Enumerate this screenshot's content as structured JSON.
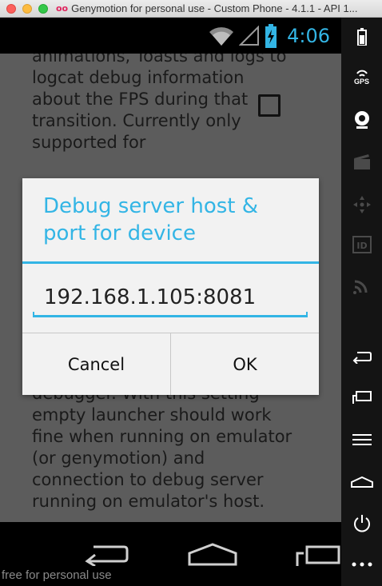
{
  "window": {
    "title": "Genymotion for personal use - Custom Phone - 4.1.1 - API 1..."
  },
  "status_bar": {
    "time": "4:06"
  },
  "background_text": {
    "top": "animations, Toasts and logs to logcat debug information about the FPS during that transition. Currently only supported for",
    "bottom": "debugger. With this setting empty launcher should work fine when running on emulator (or genymotion) and connection to debug server running on emulator's host."
  },
  "dialog": {
    "title": "Debug server host & port for device",
    "input_value": "192.168.1.105:8081",
    "cancel_label": "Cancel",
    "ok_label": "OK"
  },
  "sidebar": {
    "gps_label": "GPS"
  },
  "watermark": "free for personal use",
  "colors": {
    "accent": "#33b5e5",
    "dim_background": "#5c5c5c"
  }
}
